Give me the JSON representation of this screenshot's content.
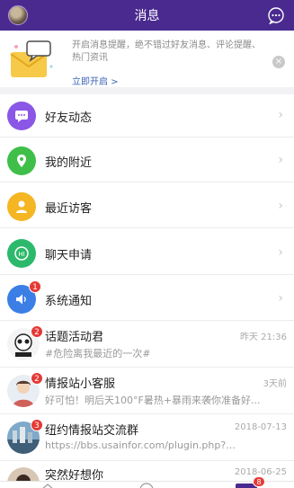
{
  "header": {
    "title": "消息",
    "avatar_icon": "user-avatar",
    "action_icon": "chat-bubble-icon"
  },
  "banner": {
    "text": "开启消息提醒，绝不错过好友消息、评论提醒、热门资讯",
    "link": "立即开启 >",
    "close": "×"
  },
  "menu": [
    {
      "label": "好友动态",
      "icon": "chat-dots-icon",
      "color": "#8b57e6",
      "badge": ""
    },
    {
      "label": "我的附近",
      "icon": "location-pin-icon",
      "color": "#3fbf4a",
      "badge": ""
    },
    {
      "label": "最近访客",
      "icon": "person-icon",
      "color": "#f5b623",
      "badge": ""
    },
    {
      "label": "聊天申请",
      "icon": "hi-icon",
      "color": "#2db96b",
      "badge": ""
    },
    {
      "label": "系统通知",
      "icon": "speaker-icon",
      "color": "#3b7fe6",
      "badge": "1"
    }
  ],
  "conversations": [
    {
      "name": "话题活动君",
      "message": "#危险离我最近的一次#",
      "time": "昨天 21:36",
      "badge": "2",
      "pic": "topic-avatar"
    },
    {
      "name": "情报站小客服",
      "message": "好可怕！明后天100°F暑热+暴雨来袭你准备好...",
      "time": "3天前",
      "badge": "2",
      "pic": "service-avatar"
    },
    {
      "name": "纽约情报站交流群",
      "message": "https://bbs.usainfor.com/plugin.php?...",
      "time": "2018-07-13",
      "badge": "3",
      "pic": "group-avatar"
    },
    {
      "name": "突然好想你",
      "message": "",
      "time": "2018-06-25",
      "badge": "",
      "pic": "friend-avatar"
    }
  ],
  "tabbar": {
    "badge": "8"
  }
}
